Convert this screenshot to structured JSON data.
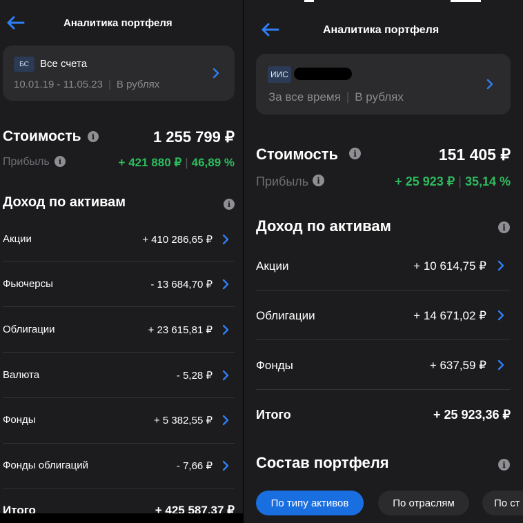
{
  "left": {
    "title": "Аналитика портфеля",
    "account": {
      "badge": "БС",
      "name": "Все счета",
      "period": "10.01.19 - 11.05.23",
      "currency": "В рублях"
    },
    "value_label": "Стоимость",
    "value": "1 255 799 ₽",
    "profit_label": "Прибыль",
    "profit_amount": "+ 421 880 ₽",
    "profit_percent": "46,89 %",
    "income_title": "Доход по активам",
    "rows": [
      {
        "label": "Акции",
        "value": "+ 410 286,65 ₽"
      },
      {
        "label": "Фьючерсы",
        "value": "- 13 684,70 ₽"
      },
      {
        "label": "Облигации",
        "value": "+ 23 615,81 ₽"
      },
      {
        "label": "Валюта",
        "value": "- 5,28 ₽"
      },
      {
        "label": "Фонды",
        "value": "+ 5 382,55 ₽"
      },
      {
        "label": "Фонды облигаций",
        "value": "- 7,66 ₽"
      }
    ],
    "total_label": "Итого",
    "total_value": "+ 425 587,37 ₽"
  },
  "right": {
    "title": "Аналитика портфеля",
    "account": {
      "badge": "ИИС",
      "period": "За все время",
      "currency": "В рублях"
    },
    "value_label": "Стоимость",
    "value": "151 405 ₽",
    "profit_label": "Прибыль",
    "profit_amount": "+ 25 923 ₽",
    "profit_percent": "35,14 %",
    "income_title": "Доход по активам",
    "rows": [
      {
        "label": "Акции",
        "value": "+ 10 614,75 ₽"
      },
      {
        "label": "Облигации",
        "value": "+ 14 671,02 ₽"
      },
      {
        "label": "Фонды",
        "value": "+ 637,59 ₽"
      }
    ],
    "total_label": "Итого",
    "total_value": "+ 25 923,36 ₽",
    "composition_title": "Состав портфеля",
    "tabs": [
      "По типу активов",
      "По отраслям",
      "По ст"
    ]
  },
  "colors": {
    "accent": "#1a6fe0",
    "profit": "#2cbb5d",
    "background": "#1c1c1e",
    "card": "#2b2b2d"
  },
  "icons": {
    "back": "arrow-left-icon",
    "chevron": "chevron-right-icon",
    "info": "info-icon"
  },
  "info_glyph": "i",
  "sep_glyph": "|"
}
